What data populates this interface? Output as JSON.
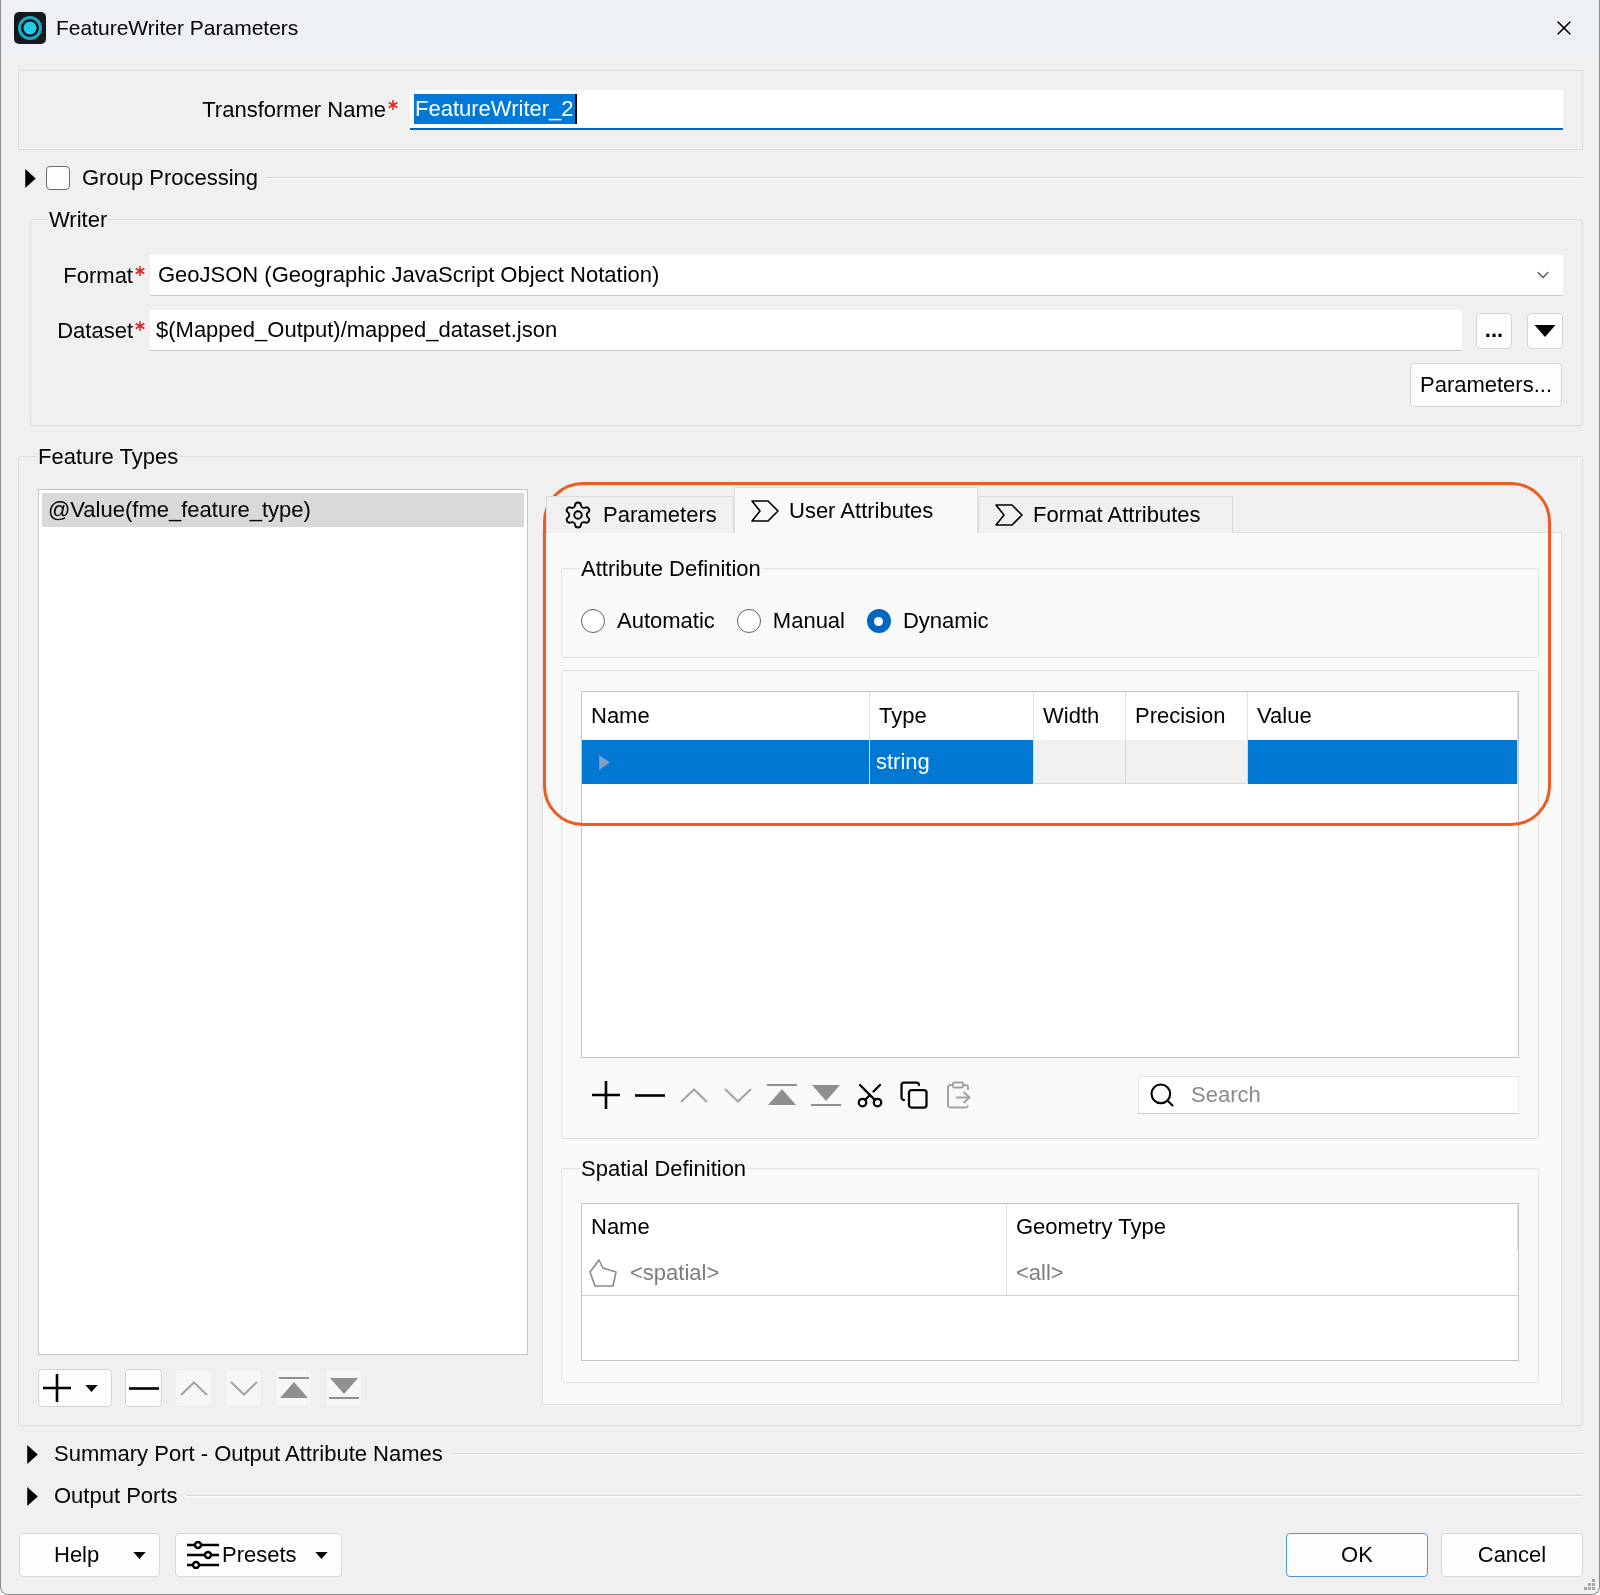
{
  "window": {
    "title": "FeatureWriter Parameters"
  },
  "transformer_name": {
    "label": "Transformer Name",
    "required": true,
    "value": "FeatureWriter_2",
    "text_selected": true
  },
  "group_processing": {
    "label": "Group Processing",
    "expanded": false,
    "checked": false
  },
  "writer": {
    "title": "Writer",
    "format": {
      "label": "Format",
      "required": true,
      "value": "GeoJSON (Geographic JavaScript Object Notation)"
    },
    "dataset": {
      "label": "Dataset",
      "required": true,
      "value": "$(Mapped_Output)/mapped_dataset.json",
      "browse_button": "..."
    },
    "parameters_button": "Parameters..."
  },
  "feature_types": {
    "title": "Feature Types",
    "items": [
      {
        "label": "@Value(fme_feature_type)",
        "selected": true
      }
    ],
    "toolbar": [
      {
        "kind": "add_menu",
        "disabled": false
      },
      {
        "kind": "remove",
        "disabled": false
      },
      {
        "kind": "up",
        "disabled": true
      },
      {
        "kind": "down",
        "disabled": true
      },
      {
        "kind": "top",
        "disabled": true
      },
      {
        "kind": "bottom",
        "disabled": true
      }
    ]
  },
  "tabs": [
    {
      "label": "Parameters",
      "kind": "gear",
      "selected": false
    },
    {
      "label": "User Attributes",
      "kind": "tag",
      "selected": true
    },
    {
      "label": "Format Attributes",
      "kind": "tag",
      "selected": false
    }
  ],
  "attribute_definition": {
    "title": "Attribute Definition",
    "options": [
      {
        "label": "Automatic",
        "selected": false
      },
      {
        "label": "Manual",
        "selected": false
      },
      {
        "label": "Dynamic",
        "selected": true
      }
    ]
  },
  "attributes_table": {
    "columns": [
      {
        "label": "Name",
        "disabled": false
      },
      {
        "label": "Type",
        "disabled": false
      },
      {
        "label": "Width",
        "disabled": true
      },
      {
        "label": "Precision",
        "disabled": true
      },
      {
        "label": "Value",
        "disabled": false
      }
    ],
    "rows": [
      {
        "type": "string",
        "selected": true
      }
    ],
    "toolbar": [
      {
        "kind": "add",
        "disabled": false
      },
      {
        "kind": "remove",
        "disabled": false
      },
      {
        "kind": "up",
        "disabled": true
      },
      {
        "kind": "down",
        "disabled": true
      },
      {
        "kind": "top",
        "disabled": true
      },
      {
        "kind": "bottom",
        "disabled": true
      },
      {
        "kind": "cut",
        "disabled": false
      },
      {
        "kind": "copy",
        "disabled": false
      },
      {
        "kind": "paste",
        "disabled": true
      }
    ],
    "search": {
      "placeholder": "Search"
    }
  },
  "spatial_definition": {
    "title": "Spatial Definition",
    "columns": [
      "Name",
      "Geometry Type"
    ],
    "rows": [
      {
        "name": "<spatial>",
        "geometry_type": "<all>",
        "disabled": true
      }
    ]
  },
  "sections": [
    {
      "label": "Summary Port - Output Attribute Names",
      "expanded": false
    },
    {
      "label": "Output Ports",
      "expanded": false
    }
  ],
  "buttons": [
    {
      "label": "Help",
      "kind": "menu"
    },
    {
      "label": "Presets",
      "kind": "presets"
    },
    {
      "label": "OK",
      "kind": "default"
    },
    {
      "label": "Cancel",
      "kind": "plain"
    }
  ],
  "highlight_outline": true
}
